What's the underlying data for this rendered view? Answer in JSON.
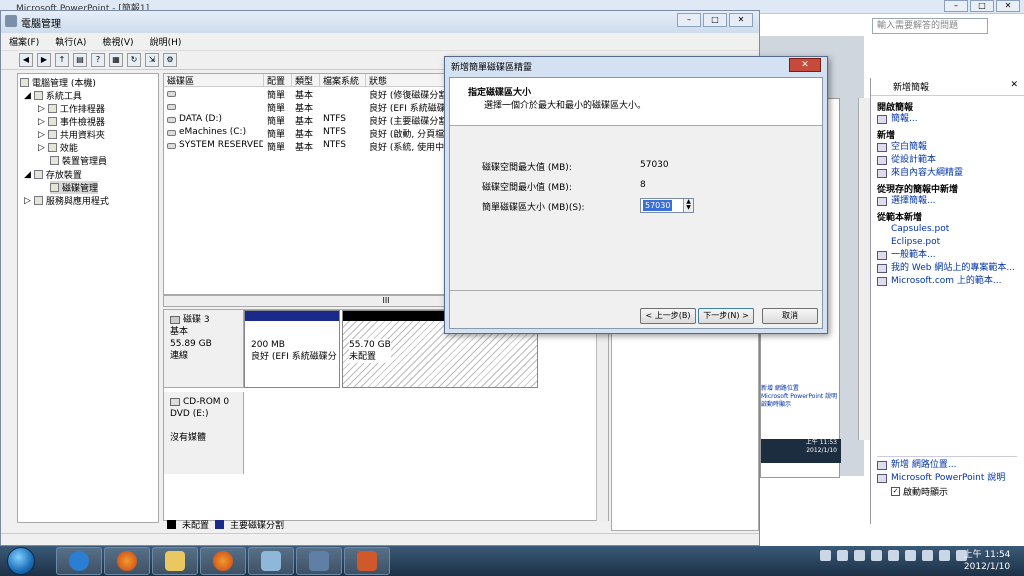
{
  "ppt": {
    "title": "Microsoft PowerPoint - [簡報1]",
    "help_placeholder": "輸入需要解答的問題",
    "pane_title": "新增簡報",
    "sections": [
      {
        "heading": "開啟簡報",
        "links": [
          "簡報..."
        ]
      },
      {
        "heading": "新增",
        "links": [
          "空白簡報",
          "從設計範本",
          "來自內容大綱精靈"
        ]
      },
      {
        "heading": "從現存的簡報中新增",
        "links": [
          "選擇簡報..."
        ]
      },
      {
        "heading": "從範本新增",
        "links": [
          "Capsules.pot",
          "Eclipse.pot",
          "一般範本...",
          "我的 Web 網站上的專案範本...",
          "Microsoft.com 上的範本..."
        ]
      }
    ],
    "bottom_links": [
      "新增 網路位置...",
      "Microsoft PowerPoint 說明"
    ],
    "startup_checkbox": "啟動時顯示"
  },
  "cm": {
    "title": "電腦管理",
    "menu": [
      "檔案(F)",
      "執行(A)",
      "檢視(V)",
      "說明(H)"
    ],
    "tree": [
      {
        "label": "電腦管理 (本機)",
        "level": 0
      },
      {
        "label": "系統工具",
        "level": 1
      },
      {
        "label": "工作排程器",
        "level": 2
      },
      {
        "label": "事件檢視器",
        "level": 2
      },
      {
        "label": "共用資料夾",
        "level": 2
      },
      {
        "label": "效能",
        "level": 2
      },
      {
        "label": "裝置管理員",
        "level": 2
      },
      {
        "label": "存放裝置",
        "level": 1
      },
      {
        "label": "磁碟管理",
        "level": 2
      },
      {
        "label": "服務與應用程式",
        "level": 1
      }
    ],
    "columns": [
      "磁碟區",
      "配置",
      "類型",
      "檔案系統",
      "狀態"
    ],
    "rows": [
      [
        "",
        "簡單",
        "基本",
        "",
        "良好 (修復磁碟分割"
      ],
      [
        "",
        "簡單",
        "基本",
        "",
        "良好 (EFI 系統磁碟分"
      ],
      [
        "DATA (D:)",
        "簡單",
        "基本",
        "NTFS",
        "良好 (主要磁碟分割"
      ],
      [
        "eMachines (C:)",
        "簡單",
        "基本",
        "NTFS",
        "良好 (啟動, 分頁檔案"
      ],
      [
        "SYSTEM RESERVED",
        "簡單",
        "基本",
        "NTFS",
        "良好 (系統, 使用中,"
      ]
    ],
    "hscroll": "III",
    "disk3": {
      "name": "磁碟 3",
      "type": "基本",
      "size": "55.89 GB",
      "status": "連線"
    },
    "part1": {
      "size": "200 MB",
      "status": "良好 (EFI 系統磁碟分"
    },
    "part2": {
      "size": "55.70 GB",
      "status": "未配置"
    },
    "cdrom": {
      "name": "CD-ROM 0",
      "drive": "DVD (E:)",
      "status": "沒有媒體"
    },
    "legend": [
      {
        "label": "未配置",
        "color": "#000000"
      },
      {
        "label": "主要磁碟分割",
        "color": "#1a2a8a"
      }
    ]
  },
  "wizard": {
    "title": "新增簡單磁碟區精靈",
    "heading": "指定磁碟區大小",
    "subheading": "選擇一個介於最大和最小的磁碟區大小。",
    "max_label": "磁碟空間最大值 (MB):",
    "max_value": "57030",
    "min_label": "磁碟空間最小值 (MB):",
    "min_value": "8",
    "size_label": "簡單磁碟區大小 (MB)(S):",
    "size_value": "57030",
    "back_button": "< 上一步(B)",
    "next_button": "下一步(N) >",
    "cancel_button": "取消"
  },
  "thumb": {
    "line1": "新增 網路位置",
    "line2": "Microsoft PowerPoint 說明",
    "line3": "啟動時顯示",
    "time": "上午 11:53",
    "date": "2012/1/10"
  },
  "taskbar": {
    "time": "上午 11:54",
    "date": "2012/1/10",
    "icons": [
      "ie-icon",
      "firefox-icon",
      "explorer-icon",
      "firefox-icon-2",
      "remote-desktop-icon",
      "computer-management-icon",
      "powerpoint-icon"
    ]
  }
}
